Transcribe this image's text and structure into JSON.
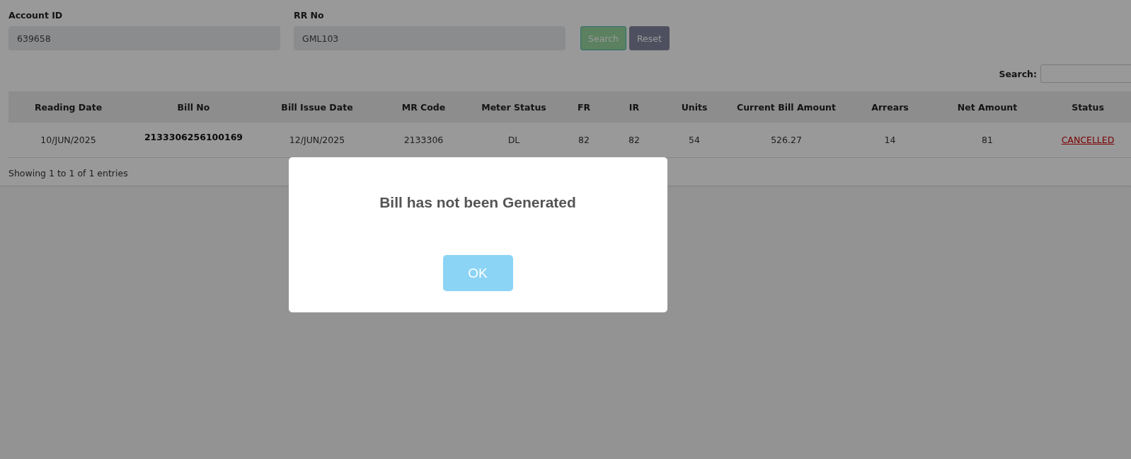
{
  "filters": [
    {
      "label": "Account ID",
      "value": "639658"
    },
    {
      "label": "RR No",
      "value": "GML103"
    }
  ],
  "buttons": [
    {
      "label": "Search",
      "kind": "primary"
    },
    {
      "label": "Reset",
      "kind": "secondary"
    }
  ],
  "table_search": {
    "label": "Search:"
  },
  "table": {
    "columns": [
      "Reading Date",
      "Bill No",
      "Bill Issue Date",
      "MR Code",
      "Meter Status",
      "FR",
      "IR",
      "Units",
      "Current Bill Amount",
      "Arrears",
      "Net Amount",
      "Status"
    ],
    "rows": [
      [
        {
          "text": "10/JUN/2025",
          "kind": "plain"
        },
        {
          "text": "2133306256100169",
          "kind": "bold"
        },
        {
          "text": "12/JUN/2025",
          "kind": "plain"
        },
        {
          "text": "2133306",
          "kind": "plain"
        },
        {
          "text": "DL",
          "kind": "plain"
        },
        {
          "text": "82",
          "kind": "plain"
        },
        {
          "text": "82",
          "kind": "plain"
        },
        {
          "text": "54",
          "kind": "plain"
        },
        {
          "text": "526.27",
          "kind": "plain"
        },
        {
          "text": "14",
          "kind": "plain"
        },
        {
          "text": "81",
          "kind": "plain"
        },
        {
          "text": "CANCELLED",
          "kind": "link"
        }
      ]
    ]
  },
  "info": "Showing 1 to 1 of 1 entries",
  "dialog": {
    "message": "Bill has not been Generated",
    "button": "OK"
  }
}
